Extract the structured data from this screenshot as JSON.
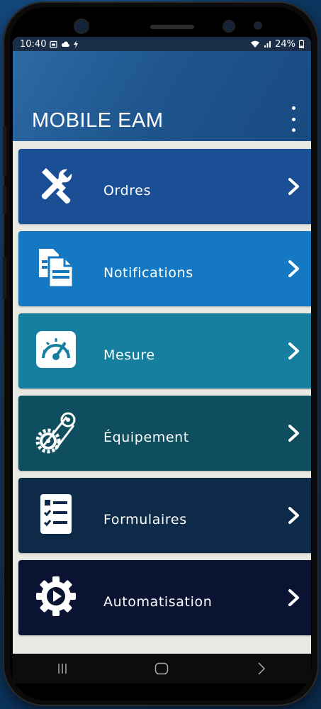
{
  "status_bar": {
    "time": "10:40",
    "left_icons": [
      "calendar-icon",
      "cloud-icon",
      "flash-icon"
    ],
    "right_icons": [
      "wifi-icon",
      "signal-icon",
      "battery-icon"
    ],
    "battery": "24%"
  },
  "app_bar": {
    "title": "MOBILE EAM",
    "overflow_icon": "more-vert-icon"
  },
  "menu": {
    "items": [
      {
        "label": "Ordres",
        "icon": "tools-icon",
        "color": "#1a4f96"
      },
      {
        "label": "Notifications",
        "icon": "documents-icon",
        "color": "#1578c2"
      },
      {
        "label": "Mesure",
        "icon": "gauge-icon",
        "color": "#167fa0"
      },
      {
        "label": "Équipement",
        "icon": "gear-chain-icon",
        "color": "#0f4e5e"
      },
      {
        "label": "Formulaires",
        "icon": "checklist-icon",
        "color": "#0d2b49"
      },
      {
        "label": "Automatisation",
        "icon": "gear-play-icon",
        "color": "#0b1332"
      }
    ],
    "chevron_icon": "chevron-right-icon"
  },
  "nav_bar": {
    "recents_icon": "recents-icon",
    "home_icon": "home-icon",
    "back_icon": "back-icon"
  }
}
